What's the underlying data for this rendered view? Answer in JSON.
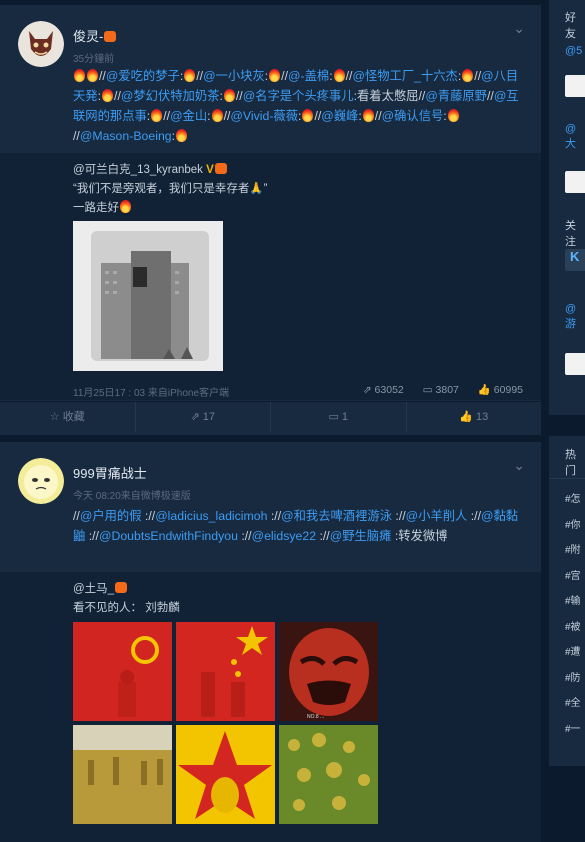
{
  "colors": {
    "page_bg": "#0c1a2d",
    "card_bg": "#172a40",
    "repost_bg": "#112236",
    "link": "#3d9cf3",
    "muted": "#5b6b80"
  },
  "post1": {
    "username": "俊灵-",
    "meta": "35分鐘前",
    "text_links": [
      "@爱吃的梦子",
      "@一小块灰",
      "@-盖棉",
      "@怪物工厂_十六杰",
      "@八目天発",
      "@梦幻伏特加奶茶",
      "@名字是个头疼事儿",
      "@青藤原野",
      "@互联网的那点事",
      "@金山",
      "@Vivid-薇薇",
      "@巍峰",
      "@确认信号",
      "@Mason-Boeing"
    ],
    "plain_text": ":看着太憋屈",
    "repost": {
      "author": "@可兰白克_13_kyranbek",
      "line1": "“我们不是旁观者，我们只是幸存者🙏”",
      "line2": "一路走好",
      "footer": "11月25日17 : 03 来自iPhone客户端",
      "reposts": "63052",
      "comments": "3807",
      "likes": "60995"
    },
    "actions": {
      "favorite": "收藏",
      "repost": "17",
      "comment": "1",
      "like": "13"
    }
  },
  "post2": {
    "username": "999胃痛战士",
    "meta": "今天 08:20来自微博极速版",
    "text_links": [
      "@户用的假",
      "@ladicius_ladicimoh",
      "@和我去啤酒裡游泳",
      "@小羊削人",
      "@黏黏鼬",
      "@DoubtsEndwithFindyou",
      "@elidsye22",
      "@野生脑瘫"
    ],
    "plain_text": ":转发微博",
    "repost": {
      "author": "@土马_",
      "line1": "看不见的人： 刘勃麟"
    },
    "photo_caption": "NO.8 ..."
  },
  "sidebar": {
    "heading1": "好友",
    "links": [
      "@5",
      "@大",
      "@游"
    ],
    "heading2": "关注",
    "heading3": "热门",
    "tags": [
      "#怎",
      "#你",
      "#附",
      "#宫",
      "#输",
      "#被",
      "#遭",
      "#防",
      "#全",
      "#一"
    ]
  }
}
